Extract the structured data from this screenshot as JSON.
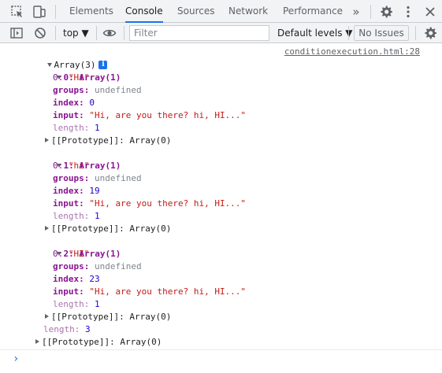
{
  "tabs": [
    {
      "label": "Elements"
    },
    {
      "label": "Console"
    },
    {
      "label": "Sources"
    },
    {
      "label": "Network"
    },
    {
      "label": "Performance"
    }
  ],
  "overflow_symbol": "»",
  "toolbar": {
    "context": "top ▼",
    "filter_placeholder": "Filter",
    "levels": "Default levels ▼",
    "issues": "No Issues"
  },
  "log": {
    "source": "conditionexecution.html:28",
    "header": "Array(3)",
    "info_badge": "i",
    "items": [
      {
        "head": "0: Array(1)",
        "k0": "0:",
        "v0": "\"Hi\"",
        "groups_k": "groups:",
        "groups_v": "undefined",
        "index_k": "index:",
        "index_v": "0",
        "input_k": "input:",
        "input_v": "\"Hi, are you there? hi, HI...\"",
        "length_k": "length:",
        "length_v": "1",
        "proto": "[[Prototype]]: Array(0)"
      },
      {
        "head": "1: Array(1)",
        "k0": "0:",
        "v0": "\"hi\"",
        "groups_k": "groups:",
        "groups_v": "undefined",
        "index_k": "index:",
        "index_v": "19",
        "input_k": "input:",
        "input_v": "\"Hi, are you there? hi, HI...\"",
        "length_k": "length:",
        "length_v": "1",
        "proto": "[[Prototype]]: Array(0)"
      },
      {
        "head": "2: Array(1)",
        "k0": "0:",
        "v0": "\"HI\"",
        "groups_k": "groups:",
        "groups_v": "undefined",
        "index_k": "index:",
        "index_v": "23",
        "input_k": "input:",
        "input_v": "\"Hi, are you there? hi, HI...\"",
        "length_k": "length:",
        "length_v": "1",
        "proto": "[[Prototype]]: Array(0)"
      }
    ],
    "length_k": "length:",
    "length_v": "3",
    "proto": "[[Prototype]]: Array(0)"
  },
  "prompt": "›",
  "colors": {
    "accent": "#1a73e8",
    "key": "#881391",
    "string": "#c41a16",
    "number": "#1c00cf"
  }
}
